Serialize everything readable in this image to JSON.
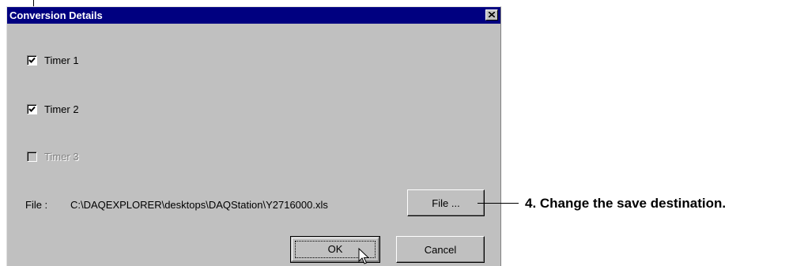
{
  "dialog": {
    "title": "Conversion Details",
    "close_icon": "close-x-icon",
    "timers": [
      {
        "label": "Timer 1",
        "checked": true,
        "enabled": true
      },
      {
        "label": "Timer 2",
        "checked": true,
        "enabled": true
      },
      {
        "label": "Timer 3",
        "checked": false,
        "enabled": false
      }
    ],
    "file_label": "File :",
    "file_path": "C:\\DAQEXPLORER\\desktops\\DAQStation\\Y2716000.xls",
    "file_button": "File ...",
    "ok_button": "OK",
    "cancel_button": "Cancel"
  },
  "annotation": {
    "callout_text": "4. Change the save destination."
  },
  "colors": {
    "titlebar": "#000080",
    "face": "#c0c0c0",
    "disabled_text": "#808080"
  }
}
